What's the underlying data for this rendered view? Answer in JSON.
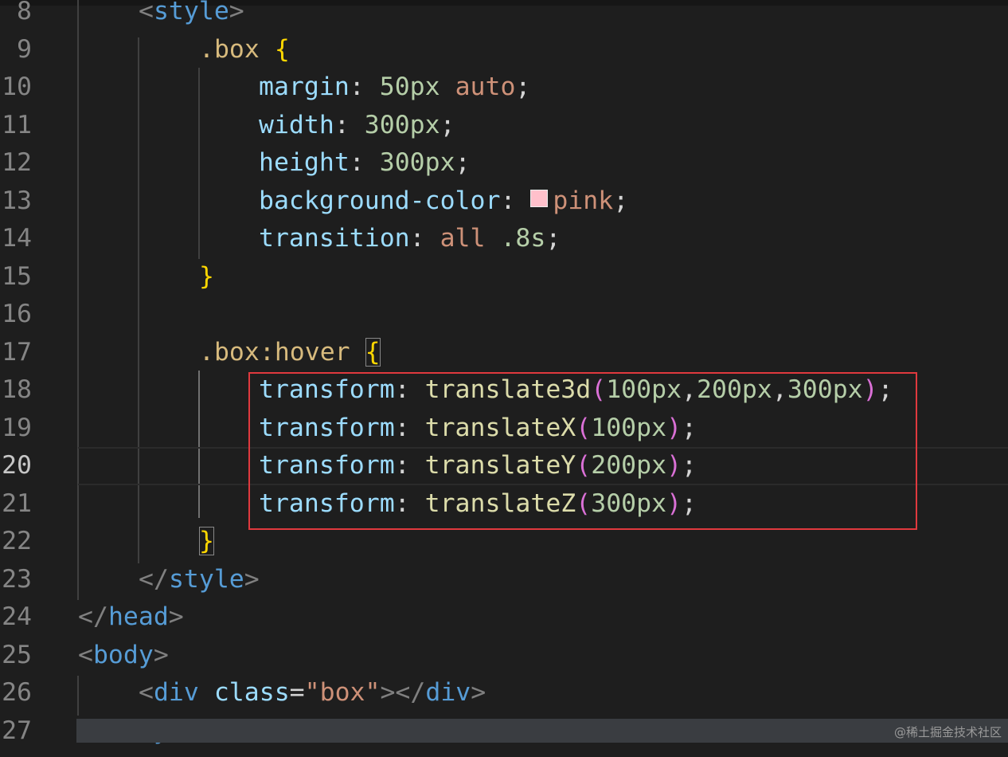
{
  "lines": [
    {
      "n": "8",
      "segs": [
        [
          "punc",
          "<"
        ],
        [
          "tag",
          "style"
        ],
        [
          "punc",
          ">"
        ]
      ]
    },
    {
      "n": "9",
      "segs": [
        [
          "sel",
          ".box"
        ],
        [
          "plain",
          " "
        ],
        [
          "brace",
          "{"
        ]
      ]
    },
    {
      "n": "10",
      "segs": [
        [
          "prop",
          "margin"
        ],
        [
          "plain",
          ": "
        ],
        [
          "num",
          "50px"
        ],
        [
          "plain",
          " "
        ],
        [
          "kw",
          "auto"
        ],
        [
          "plain",
          ";"
        ]
      ]
    },
    {
      "n": "11",
      "segs": [
        [
          "prop",
          "width"
        ],
        [
          "plain",
          ": "
        ],
        [
          "num",
          "300px"
        ],
        [
          "plain",
          ";"
        ]
      ]
    },
    {
      "n": "12",
      "segs": [
        [
          "prop",
          "height"
        ],
        [
          "plain",
          ": "
        ],
        [
          "num",
          "300px"
        ],
        [
          "plain",
          ";"
        ]
      ]
    },
    {
      "n": "13",
      "segs": [
        [
          "prop",
          "background-color"
        ],
        [
          "plain",
          ": "
        ],
        [
          "swatch",
          ""
        ],
        [
          "kw",
          "pink"
        ],
        [
          "plain",
          ";"
        ]
      ]
    },
    {
      "n": "14",
      "segs": [
        [
          "prop",
          "transition"
        ],
        [
          "plain",
          ": "
        ],
        [
          "kw",
          "all"
        ],
        [
          "plain",
          " "
        ],
        [
          "num",
          ".8s"
        ],
        [
          "plain",
          ";"
        ]
      ]
    },
    {
      "n": "15",
      "segs": [
        [
          "brace",
          "}"
        ]
      ]
    },
    {
      "n": "16",
      "segs": []
    },
    {
      "n": "17",
      "segs": [
        [
          "sel",
          ".box:hover"
        ],
        [
          "plain",
          " "
        ],
        [
          "brace match",
          "{"
        ]
      ]
    },
    {
      "n": "18",
      "segs": [
        [
          "prop",
          "transform"
        ],
        [
          "plain",
          ": "
        ],
        [
          "fn",
          "translate3d"
        ],
        [
          "paren",
          "("
        ],
        [
          "num",
          "100px"
        ],
        [
          "plain",
          ","
        ],
        [
          "num",
          "200px"
        ],
        [
          "plain",
          ","
        ],
        [
          "num",
          "300px"
        ],
        [
          "paren",
          ")"
        ],
        [
          "plain",
          ";"
        ]
      ]
    },
    {
      "n": "19",
      "segs": [
        [
          "prop",
          "transform"
        ],
        [
          "plain",
          ": "
        ],
        [
          "fn",
          "translateX"
        ],
        [
          "paren",
          "("
        ],
        [
          "num",
          "100px"
        ],
        [
          "paren",
          ")"
        ],
        [
          "plain",
          ";"
        ]
      ]
    },
    {
      "n": "20",
      "segs": [
        [
          "prop",
          "transform"
        ],
        [
          "plain",
          ": "
        ],
        [
          "fn",
          "translateY"
        ],
        [
          "paren",
          "("
        ],
        [
          "num",
          "200px"
        ],
        [
          "paren",
          ")"
        ],
        [
          "plain",
          ";"
        ]
      ]
    },
    {
      "n": "21",
      "segs": [
        [
          "prop",
          "transform"
        ],
        [
          "plain",
          ": "
        ],
        [
          "fn",
          "translateZ"
        ],
        [
          "paren",
          "("
        ],
        [
          "num",
          "300px"
        ],
        [
          "paren",
          ")"
        ],
        [
          "plain",
          ";"
        ]
      ]
    },
    {
      "n": "22",
      "segs": [
        [
          "brace match",
          "}"
        ]
      ]
    },
    {
      "n": "23",
      "segs": [
        [
          "punc",
          "</"
        ],
        [
          "tag",
          "style"
        ],
        [
          "punc",
          ">"
        ]
      ]
    },
    {
      "n": "24",
      "segs": [
        [
          "punc",
          "</"
        ],
        [
          "tag",
          "head"
        ],
        [
          "punc",
          ">"
        ]
      ]
    },
    {
      "n": "25",
      "segs": [
        [
          "punc",
          "<"
        ],
        [
          "tag",
          "body"
        ],
        [
          "punc",
          ">"
        ]
      ]
    },
    {
      "n": "26",
      "segs": [
        [
          "punc",
          "<"
        ],
        [
          "tag",
          "div"
        ],
        [
          "plain",
          " "
        ],
        [
          "attr",
          "class"
        ],
        [
          "plain",
          "="
        ],
        [
          "str",
          "\"box\""
        ],
        [
          "punc",
          "></"
        ],
        [
          "tag",
          "div"
        ],
        [
          "punc",
          ">"
        ]
      ]
    },
    {
      "n": "27",
      "segs": [
        [
          "punc",
          "</"
        ],
        [
          "tag",
          "body"
        ],
        [
          "punc",
          ">"
        ]
      ]
    }
  ],
  "current_line": "20",
  "watermark": "@稀土掘金技术社区"
}
